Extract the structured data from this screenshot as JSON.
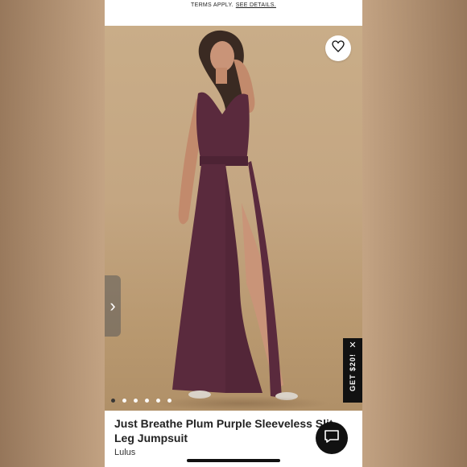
{
  "banner": {
    "prefix": "TERMS APPLY.",
    "link": "SEE DETAILS."
  },
  "gallery": {
    "slide_count": 6,
    "active_index": 0,
    "next_arrow": "›"
  },
  "favorite": {
    "icon": "heart-icon"
  },
  "promo": {
    "label": "GET $20!",
    "close": "✕"
  },
  "product": {
    "title": "Just Breathe Plum Purple Sleeveless Slit-Leg Jumpsuit",
    "brand": "Lulus"
  },
  "chat": {
    "icon": "chat-icon"
  },
  "colors": {
    "dress": "#5a2a3d",
    "background": "#c4a682",
    "accent": "#111111"
  }
}
